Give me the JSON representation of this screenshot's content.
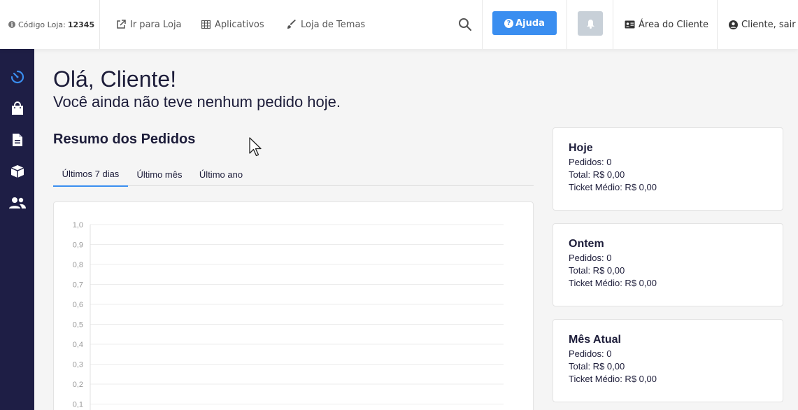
{
  "header": {
    "store_code_label": "Código Loja:",
    "store_code_value": "12345",
    "nav": {
      "goto_store": "Ir para Loja",
      "apps": "Aplicativos",
      "themes": "Loja de Temas"
    },
    "help_label": "Ajuda",
    "client_area": "Área do Cliente",
    "logout": "Cliente, sair"
  },
  "sidebar": {
    "items": [
      "dashboard-icon",
      "orders-bag-icon",
      "document-icon",
      "box-icon",
      "users-icon"
    ]
  },
  "main": {
    "greeting": "Olá, Cliente!",
    "subgreeting": "Você ainda não teve nenhum pedido hoje.",
    "section_title": "Resumo dos Pedidos",
    "tabs": [
      {
        "label": "Últimos 7 dias",
        "active": true
      },
      {
        "label": "Último mês",
        "active": false
      },
      {
        "label": "Último ano",
        "active": false
      }
    ]
  },
  "chart_data": {
    "type": "line",
    "y_ticks": [
      "1,0",
      "0,9",
      "0,8",
      "0,7",
      "0,6",
      "0,5",
      "0,4",
      "0,3",
      "0,2",
      "0,1"
    ],
    "ylim": [
      0,
      1
    ],
    "grid": true,
    "series": []
  },
  "stats": [
    {
      "title": "Hoje",
      "orders": "Pedidos: 0",
      "total": "Total: R$ 0,00",
      "ticket": "Ticket Médio: R$ 0,00"
    },
    {
      "title": "Ontem",
      "orders": "Pedidos: 0",
      "total": "Total: R$ 0,00",
      "ticket": "Ticket Médio: R$ 0,00"
    },
    {
      "title": "Mês Atual",
      "orders": "Pedidos: 0",
      "total": "Total: R$ 0,00",
      "ticket": "Ticket Médio: R$ 0,00"
    }
  ],
  "colors": {
    "accent": "#3a8ef0",
    "sidebar": "#1e1e45",
    "sidebar_active_icon": "#3a8ef0"
  }
}
